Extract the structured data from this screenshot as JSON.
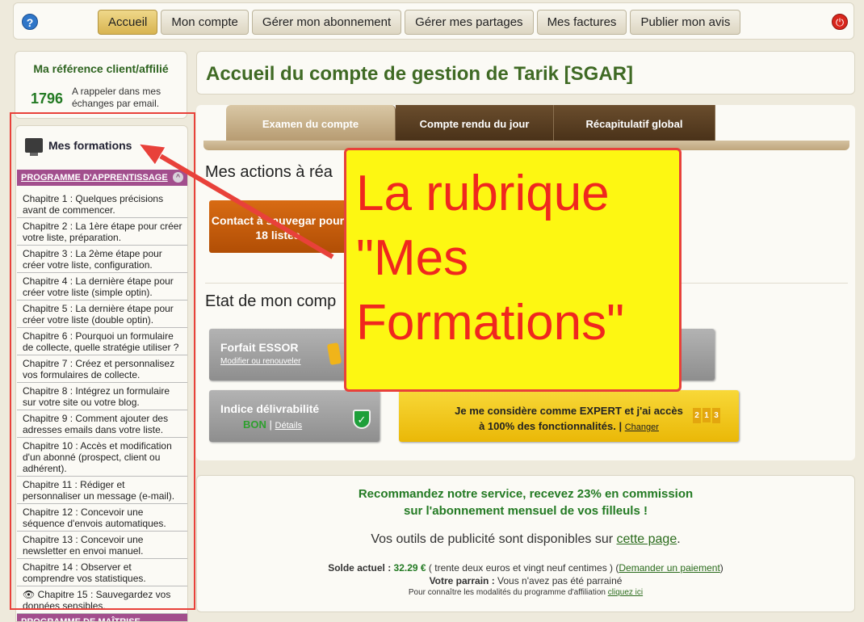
{
  "topbar": {
    "help": "?",
    "power": "⏻",
    "tabs": [
      {
        "label": "Accueil",
        "active": true
      },
      {
        "label": "Mon compte"
      },
      {
        "label": "Gérer mon abonnement"
      },
      {
        "label": "Gérer mes partages"
      },
      {
        "label": "Mes factures"
      },
      {
        "label": "Publier mon avis"
      }
    ]
  },
  "ref": {
    "title": "Ma référence client/affilié",
    "number": "1796",
    "note": "A rappeler dans mes échanges par email."
  },
  "formations": {
    "title": "Mes formations",
    "section1": "PROGRAMME D'APPRENTISSAGE",
    "section2": "PROGRAMME DE MAÎTRISE",
    "chapters": [
      "Chapitre 1 : Quelques précisions avant de commencer.",
      "Chapitre 2 : La 1ère étape pour créer votre liste, préparation.",
      "Chapitre 3 : La 2ème étape pour créer votre liste, configuration.",
      "Chapitre 4 : La dernière étape pour créer votre liste (simple optin).",
      "Chapitre 5 : La dernière étape pour créer votre liste (double optin).",
      "Chapitre 6 : Pourquoi un formulaire de collecte, quelle stratégie utiliser ?",
      "Chapitre 7 : Créez et personnalisez vos formulaires de collecte.",
      "Chapitre 8 : Intégrez un formulaire sur votre site ou votre blog.",
      "Chapitre 9 : Comment ajouter des adresses emails dans votre liste.",
      "Chapitre 10 : Accès et modification d'un abonné (prospect, client ou adhérent).",
      "Chapitre 11 : Rédiger et personnaliser un message (e-mail).",
      "Chapitre 12 : Concevoir une séquence d'envois automatiques.",
      "Chapitre 13 : Concevoir une newsletter en envoi manuel.",
      "Chapitre 14 : Observer et comprendre vos statistiques.",
      "👁 Chapitre 15 : Sauvegardez vos données sensibles."
    ]
  },
  "header": {
    "title": "Accueil du compte de gestion de Tarik [SGAR]"
  },
  "subtabs": [
    {
      "label": "Examen du compte",
      "active": true
    },
    {
      "label": "Compte rendu du jour"
    },
    {
      "label": "Récapitulatif global"
    }
  ],
  "actions": {
    "heading": "Mes actions à réa",
    "button": "Contact à sauvegar pour 18 listes"
  },
  "etat": {
    "heading": "Etat de mon comp"
  },
  "forfait": {
    "title": "Forfait ESSOR",
    "link": "Modifier ou renouveler"
  },
  "indice": {
    "title": "Indice délivrabilité",
    "value": "BON",
    "sep": "|",
    "link": "Détails"
  },
  "expert": {
    "line1": "Je me considère comme EXPERT et j'ai accès",
    "line2": "à 100% des fonctionnalités.",
    "sep": "|",
    "link": "Changer",
    "podium": [
      "2",
      "1",
      "3"
    ]
  },
  "promo": {
    "line1": "Recommandez notre service, recevez 23% en commission",
    "line2": "sur l'abonnement mensuel de vos filleuls !",
    "tools": "Vos outils de publicité sont disponibles sur ",
    "tools_link": "cette page",
    "tools_end": ".",
    "solde_label": "Solde actuel : ",
    "solde_value": "32.29 €",
    "solde_words": " ( trente deux euros et vingt neuf centimes ) (",
    "solde_link": "Demander un paiement",
    "solde_end": ")",
    "parrain_label": "Votre parrain : ",
    "parrain_value": "Vous n'avez pas été parrainé",
    "modal": "Pour connaître les modalités du programme d'affiliation ",
    "modal_link": "cliquez ici"
  },
  "callout": {
    "line1": "La rubrique",
    "line2": "\"Mes",
    "line3": "Formations\""
  },
  "colors": {
    "accent": "#3f6a24",
    "callout": "#fdf712",
    "red": "#e8413a"
  }
}
